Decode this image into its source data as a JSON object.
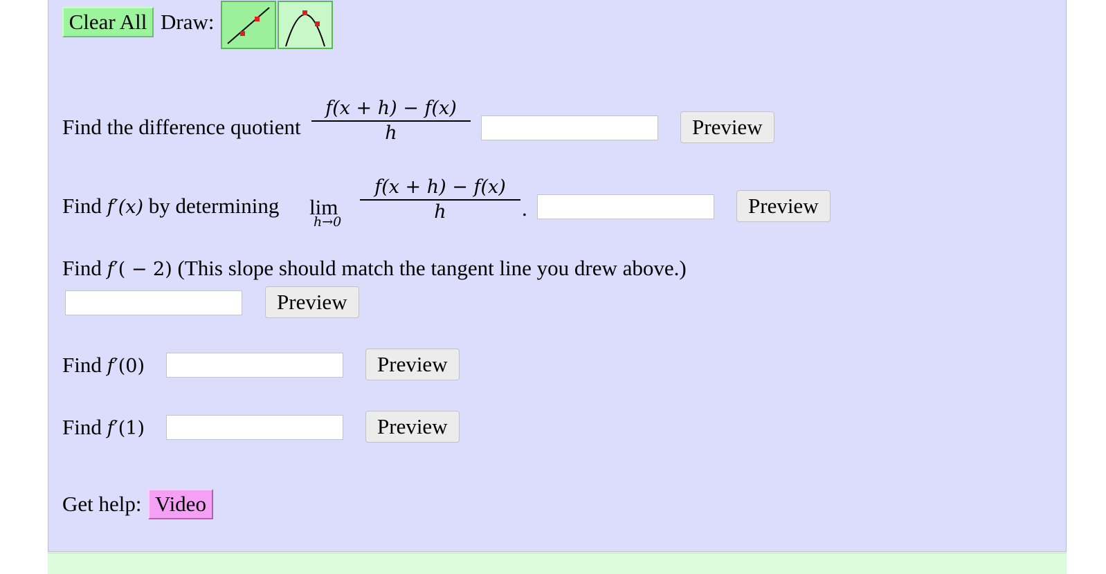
{
  "toolbar": {
    "clear_all_label": "Clear All",
    "draw_label": "Draw:",
    "tools": [
      {
        "name": "line-tool",
        "icon": "line-icon"
      },
      {
        "name": "parabola-tool",
        "icon": "parabola-icon"
      }
    ]
  },
  "questions": {
    "q1": {
      "prefix": "Find the difference quotient",
      "numerator": "f(x + h) − f(x)",
      "denominator": "h",
      "answer": "",
      "preview_label": "Preview"
    },
    "q2": {
      "prefix": "Find",
      "func": "f",
      "prime_arg": "′(x)",
      "middle": "by determining",
      "lim": "lim",
      "lim_sub": "h→0",
      "numerator": "f(x + h) − f(x)",
      "denominator": "h",
      "period": ".",
      "answer": "",
      "preview_label": "Preview"
    },
    "q3": {
      "prefix": "Find",
      "func": "f",
      "prime_arg": "′( − 2)",
      "suffix": "(This slope should match the tangent line you drew above.)",
      "answer": "",
      "preview_label": "Preview"
    },
    "q4": {
      "prefix": "Find",
      "func": "f",
      "prime_arg": "′(0)",
      "answer": "",
      "preview_label": "Preview"
    },
    "q5": {
      "prefix": "Find",
      "func": "f",
      "prime_arg": "′(1)",
      "answer": "",
      "preview_label": "Preview"
    }
  },
  "help": {
    "label": "Get help:",
    "video_label": "Video"
  },
  "colors": {
    "panel_bg": "#dcdcfc",
    "green_button": "#9cf49c",
    "video_button": "#f4a0f4",
    "point_red": "#e02020"
  }
}
